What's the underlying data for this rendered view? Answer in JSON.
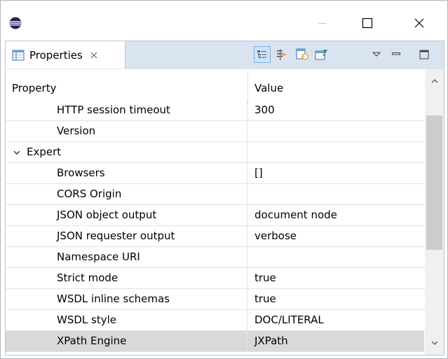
{
  "window": {
    "controls": {
      "minimize": "minimize",
      "maximize": "maximize",
      "close": "close"
    }
  },
  "view": {
    "tab_label": "Properties",
    "toolbar": [
      {
        "icon": "show-categories-icon",
        "active": true
      },
      {
        "icon": "show-advanced-icon",
        "active": false
      },
      {
        "icon": "restore-defaults-icon",
        "active": false
      },
      {
        "icon": "pin-icon",
        "active": false
      },
      {
        "icon": "view-menu-icon",
        "active": false
      },
      {
        "icon": "minimize-view-icon",
        "active": false
      },
      {
        "icon": "maximize-view-icon",
        "active": false
      }
    ]
  },
  "table": {
    "columns": {
      "property": "Property",
      "value": "Value"
    },
    "rows": [
      {
        "property": "HTTP session timeout",
        "value": "300",
        "indent": 2,
        "selected": false
      },
      {
        "property": "Version",
        "value": "",
        "indent": 2,
        "selected": false
      },
      {
        "property": "Expert",
        "value": "",
        "indent": 1,
        "category": true,
        "expanded": true,
        "selected": false
      },
      {
        "property": "Browsers",
        "value": "[]",
        "indent": 2,
        "selected": false
      },
      {
        "property": "CORS Origin",
        "value": "",
        "indent": 2,
        "selected": false
      },
      {
        "property": "JSON object output",
        "value": "document node",
        "indent": 2,
        "selected": false
      },
      {
        "property": "JSON requester output",
        "value": "verbose",
        "indent": 2,
        "selected": false
      },
      {
        "property": "Namespace URI",
        "value": "",
        "indent": 2,
        "selected": false
      },
      {
        "property": "Strict mode",
        "value": "true",
        "indent": 2,
        "selected": false
      },
      {
        "property": "WSDL inline schemas",
        "value": "true",
        "indent": 2,
        "selected": false
      },
      {
        "property": "WSDL style",
        "value": "DOC/LITERAL",
        "indent": 2,
        "selected": false
      },
      {
        "property": "XPath Engine",
        "value": "JXPath",
        "indent": 2,
        "selected": true
      }
    ]
  },
  "scrollbar": {
    "position_fraction": 0.25,
    "visible_fraction": 0.55
  }
}
